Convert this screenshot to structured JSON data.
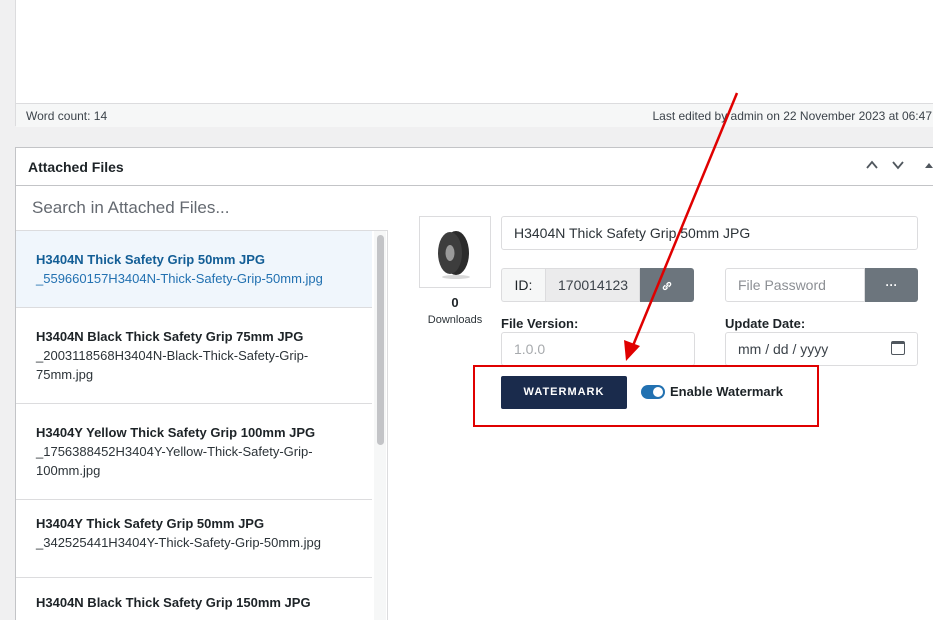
{
  "editor": {
    "word_count": "Word count: 14",
    "last_edited": "Last edited by admin on 22 November 2023 at 06:47"
  },
  "panel": {
    "title": "Attached Files",
    "search_placeholder": "Search in Attached Files...",
    "files": [
      {
        "title": "H3404N Thick Safety Grip 50mm JPG",
        "filename": "_559660157H3404N-Thick-Safety-Grip-50mm.jpg",
        "active": true
      },
      {
        "title": "H3404N Black Thick Safety Grip 75mm JPG",
        "filename": "_2003118568H3404N-Black-Thick-Safety-Grip-75mm.jpg",
        "active": false
      },
      {
        "title": "H3404Y Yellow Thick Safety Grip 100mm JPG",
        "filename": "_1756388452H3404Y-Yellow-Thick-Safety-Grip-100mm.jpg",
        "active": false
      },
      {
        "title": "H3404Y Thick Safety Grip 50mm JPG",
        "filename": "_342525441H3404Y-Thick-Safety-Grip-50mm.jpg",
        "active": false
      },
      {
        "title": "H3404N Black Thick Safety Grip 150mm JPG",
        "filename": "",
        "active": false
      }
    ]
  },
  "details": {
    "downloads_count": "0",
    "downloads_label": "Downloads",
    "file_title": "H3404N Thick Safety Grip 50mm JPG",
    "id_label": "ID:",
    "id_value": "170014123",
    "password_placeholder": "File Password",
    "dots_label": "···",
    "version_label": "File Version:",
    "version_placeholder": "1.0.0",
    "date_label": "Update Date:",
    "date_placeholder": "mm / dd / yyyy",
    "watermark_button": "WATERMARK",
    "watermark_toggle_label": "Enable Watermark",
    "watermark_enabled": true
  },
  "colors": {
    "annotation": "#e00000",
    "watermark_button": "#1a2b4c",
    "toggle_on": "#2271b1"
  }
}
